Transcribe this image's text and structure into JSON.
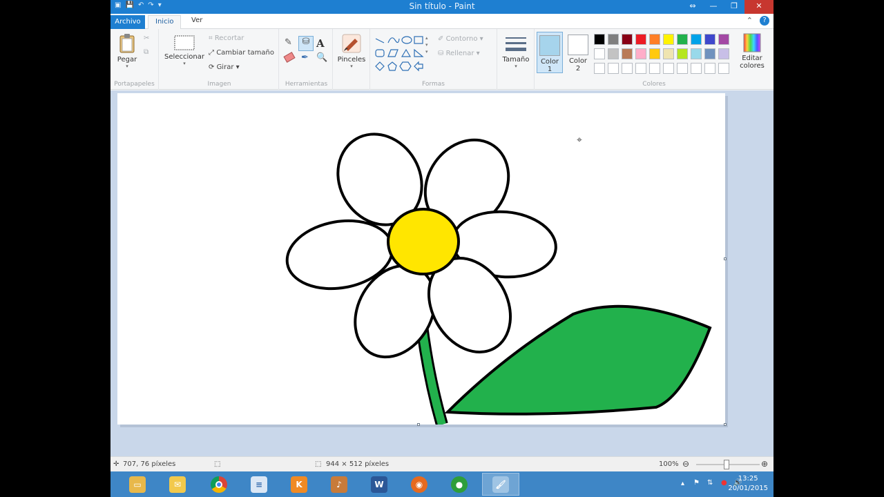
{
  "window": {
    "title": "Sin título - Paint",
    "qat_icons": [
      "paint-app-icon",
      "save-icon",
      "undo-icon",
      "redo-icon",
      "customize-icon"
    ]
  },
  "tabs": {
    "archivo": "Archivo",
    "inicio": "Inicio",
    "ver": "Ver"
  },
  "ribbon": {
    "portapapeles": {
      "paste": "Pegar",
      "cut": "",
      "copy": "",
      "label": "Portapapeles"
    },
    "imagen": {
      "select": "Seleccionar",
      "crop": "Recortar",
      "resize": "Cambiar tamaño",
      "rotate": "Girar",
      "label": "Imagen"
    },
    "herramientas": {
      "label": "Herramientas",
      "text_tool": "A"
    },
    "pinceles": {
      "label": "Pinceles"
    },
    "formas": {
      "outline": "Contorno",
      "fill": "Rellenar",
      "label": "Formas"
    },
    "tamano": {
      "label": "Tamaño"
    },
    "colores": {
      "color1": "Color",
      "color1_num": "1",
      "color2": "Color",
      "color2_num": "2",
      "color1_value": "#a6d4ec",
      "color2_value": "#ffffff",
      "edit": "Editar",
      "edit2": "colores",
      "label": "Colores",
      "palette_row1": [
        "#000000",
        "#7f7f7f",
        "#880015",
        "#ed1c24",
        "#ff7f27",
        "#fff200",
        "#22b14c",
        "#00a2e8",
        "#3f48cc",
        "#a349a4"
      ],
      "palette_row2": [
        "#ffffff",
        "#c3c3c3",
        "#b97a57",
        "#ffaec9",
        "#ffc90e",
        "#efe4b0",
        "#b5e61d",
        "#99d9ea",
        "#7092be",
        "#c8bfe7"
      ]
    }
  },
  "canvas": {
    "flower_center_color": "#ffe600",
    "leaf_color": "#22b14c",
    "petal_color": "#ffffff",
    "outline_color": "#000000"
  },
  "status": {
    "cursor_pos": "707, 76 píxeles",
    "image_size": "944 × 512 píxeles",
    "zoom": "100%"
  },
  "taskbar": {
    "apps": [
      "file-explorer-icon",
      "mail-icon",
      "chrome-icon",
      "notepad-icon",
      "kt-app-icon",
      "media-app-icon",
      "word-icon",
      "firefox-icon",
      "green-ball-app-icon",
      "paint-taskbar-icon"
    ],
    "time": "13:25",
    "date": "20/01/2015"
  }
}
